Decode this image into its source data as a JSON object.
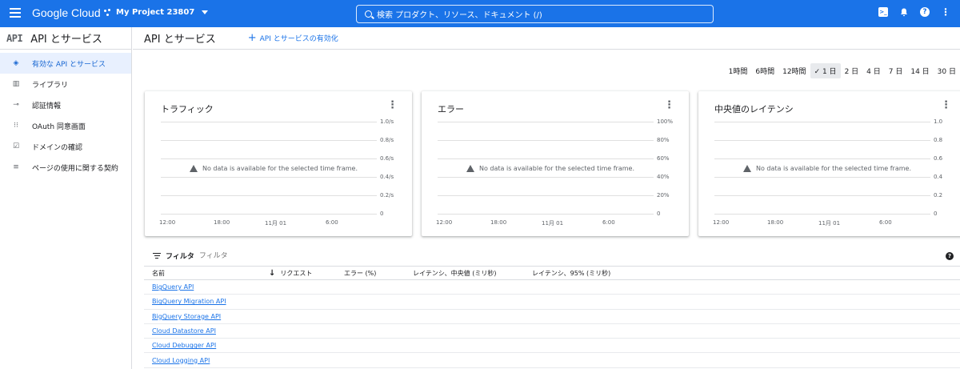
{
  "topbar": {
    "logo": "Google Cloud",
    "project": "My Project 23807",
    "search_placeholder": "検索 プロダクト、リソース、ドキュメント (/)"
  },
  "sidebar": {
    "mark": "API",
    "title": "API とサービス",
    "items": [
      {
        "label": "有効な API とサービス",
        "icon": "diamond-icon",
        "glyph": "◈"
      },
      {
        "label": "ライブラリ",
        "icon": "library-icon",
        "glyph": "▥"
      },
      {
        "label": "認証情報",
        "icon": "key-icon",
        "glyph": "⊸"
      },
      {
        "label": "OAuth 同意画面",
        "icon": "consent-icon",
        "glyph": "⁝⁝"
      },
      {
        "label": "ドメインの確認",
        "icon": "checkbox-icon",
        "glyph": "☑"
      },
      {
        "label": "ページの使用に関する契約",
        "icon": "settings-list-icon",
        "glyph": "≡"
      }
    ]
  },
  "main": {
    "title": "API とサービス",
    "enable_label": "API とサービスの有効化"
  },
  "time_range": {
    "options": [
      "1時間",
      "6時間",
      "12時間",
      "1 日",
      "2 日",
      "4 日",
      "7 日",
      "14 日",
      "30 日"
    ],
    "selected": "1 日"
  },
  "charts": [
    {
      "title": "トラフィック",
      "y_ticks": [
        "1.0/s",
        "0.8/s",
        "0.6/s",
        "0.4/s",
        "0.2/s",
        "0"
      ],
      "x_ticks": [
        "12:00",
        "18:00",
        "11月 01",
        "6:00"
      ]
    },
    {
      "title": "エラー",
      "y_ticks": [
        "100%",
        "80%",
        "60%",
        "40%",
        "20%",
        "0"
      ],
      "x_ticks": [
        "12:00",
        "18:00",
        "11月 01",
        "6:00"
      ]
    },
    {
      "title": "中央値のレイテンシ",
      "y_ticks": [
        "1.0",
        "0.8",
        "0.6",
        "0.4",
        "0.2",
        "0"
      ],
      "x_ticks": [
        "12:00",
        "18:00",
        "11月 01",
        "6:00"
      ]
    }
  ],
  "no_data_message": "No data is available for the selected time frame.",
  "table": {
    "filter_label": "フィルタ",
    "filter_placeholder": "フィルタ",
    "columns": [
      "名前",
      "リクエスト",
      "エラー (%)",
      "レイテンシ、中央値 (ミリ秒)",
      "レイテンシ、95% (ミリ秒)"
    ],
    "rows": [
      "BigQuery API",
      "BigQuery Migration API",
      "BigQuery Storage API",
      "Cloud Datastore API",
      "Cloud Debugger API",
      "Cloud Logging API"
    ]
  },
  "colors": {
    "brand": "#1a73e8",
    "active_bg": "#e8f0fe"
  }
}
